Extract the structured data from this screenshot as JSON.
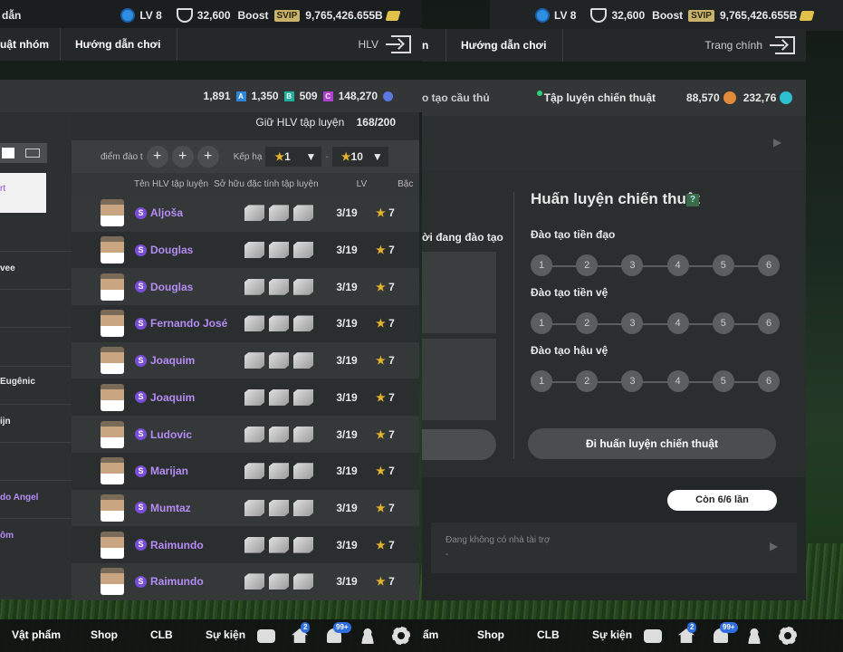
{
  "left": {
    "top": {
      "title": "dẫn",
      "lv": "LV 8",
      "points": "32,600",
      "boost": "Boost",
      "svip": "SVIP",
      "coins": "9,765,426.655B"
    },
    "nav": {
      "tab1": "uật nhóm",
      "tab2": "Hướng dẫn chơi",
      "right": "HLV"
    },
    "currency": {
      "a_val": "1,891",
      "a_tag": "A",
      "b_val": "1,350",
      "b_tag": "B",
      "c_val": "509",
      "c_tag": "C",
      "d_val": "148,270"
    },
    "keep_label": "Giữ HLV tập luyện",
    "keep_value": "168/200",
    "filter": {
      "label": "điểm đào t",
      "rank_label": "Kếp hạ",
      "from": "1",
      "to": "10"
    },
    "columns": {
      "name": "Tên HLV tập luyện",
      "trait": "Sở hữu đặc tính tập luyện",
      "lv": "LV",
      "grade": "Bậc"
    },
    "side_items": [
      "rt",
      "vee",
      "Eugênic",
      "ijn",
      "do Angel",
      "ôm"
    ],
    "coaches": [
      {
        "name": "Aljoša",
        "lv": "3/19",
        "grade": "7"
      },
      {
        "name": "Douglas",
        "lv": "3/19",
        "grade": "7"
      },
      {
        "name": "Douglas",
        "lv": "3/19",
        "grade": "7"
      },
      {
        "name": "Fernando José",
        "lv": "3/19",
        "grade": "7"
      },
      {
        "name": "Joaquim",
        "lv": "3/19",
        "grade": "7"
      },
      {
        "name": "Joaquim",
        "lv": "3/19",
        "grade": "7"
      },
      {
        "name": "Ludovic",
        "lv": "3/19",
        "grade": "7"
      },
      {
        "name": "Marijan",
        "lv": "3/19",
        "grade": "7"
      },
      {
        "name": "Mumtaz",
        "lv": "3/19",
        "grade": "7"
      },
      {
        "name": "Raimundo",
        "lv": "3/19",
        "grade": "7"
      },
      {
        "name": "Raimundo",
        "lv": "3/19",
        "grade": "7"
      }
    ]
  },
  "right": {
    "top": {
      "lv": "LV 8",
      "points": "32,600",
      "boost": "Boost",
      "svip": "SVIP",
      "coins": "9,765,426.655B"
    },
    "nav": {
      "tab1": "n",
      "tab2": "Hướng dẫn chơi",
      "right": "Trang chính"
    },
    "tabs": {
      "t1": "o tạo cầu thủ",
      "t2": "Tập luyện chiến thuật",
      "v1": "88,570",
      "v2": "232,76"
    },
    "training_label": "ời đang đào tạo",
    "title": "Huấn luyện chiến thuật",
    "help": "?",
    "sections": [
      {
        "label": "Đào tạo tiền đạo"
      },
      {
        "label": "Đào tạo tiền vệ"
      },
      {
        "label": "Đào tạo hậu vệ"
      }
    ],
    "steps": [
      "1",
      "2",
      "3",
      "4",
      "5",
      "6"
    ],
    "go_button": "Đi huấn luyện chiến thuật",
    "remaining": "Còn 6/6 lần",
    "sponsor": "Đang không có nhà tài trợ",
    "sponsor_sub": "-"
  },
  "bottom": {
    "items": [
      "Vật phẩm",
      "Shop",
      "CLB",
      "Sự kiện"
    ],
    "right_items": [
      "ẩm",
      "Shop",
      "CLB",
      "Sự kiện"
    ],
    "badge1": "2",
    "badge2": "99+"
  }
}
